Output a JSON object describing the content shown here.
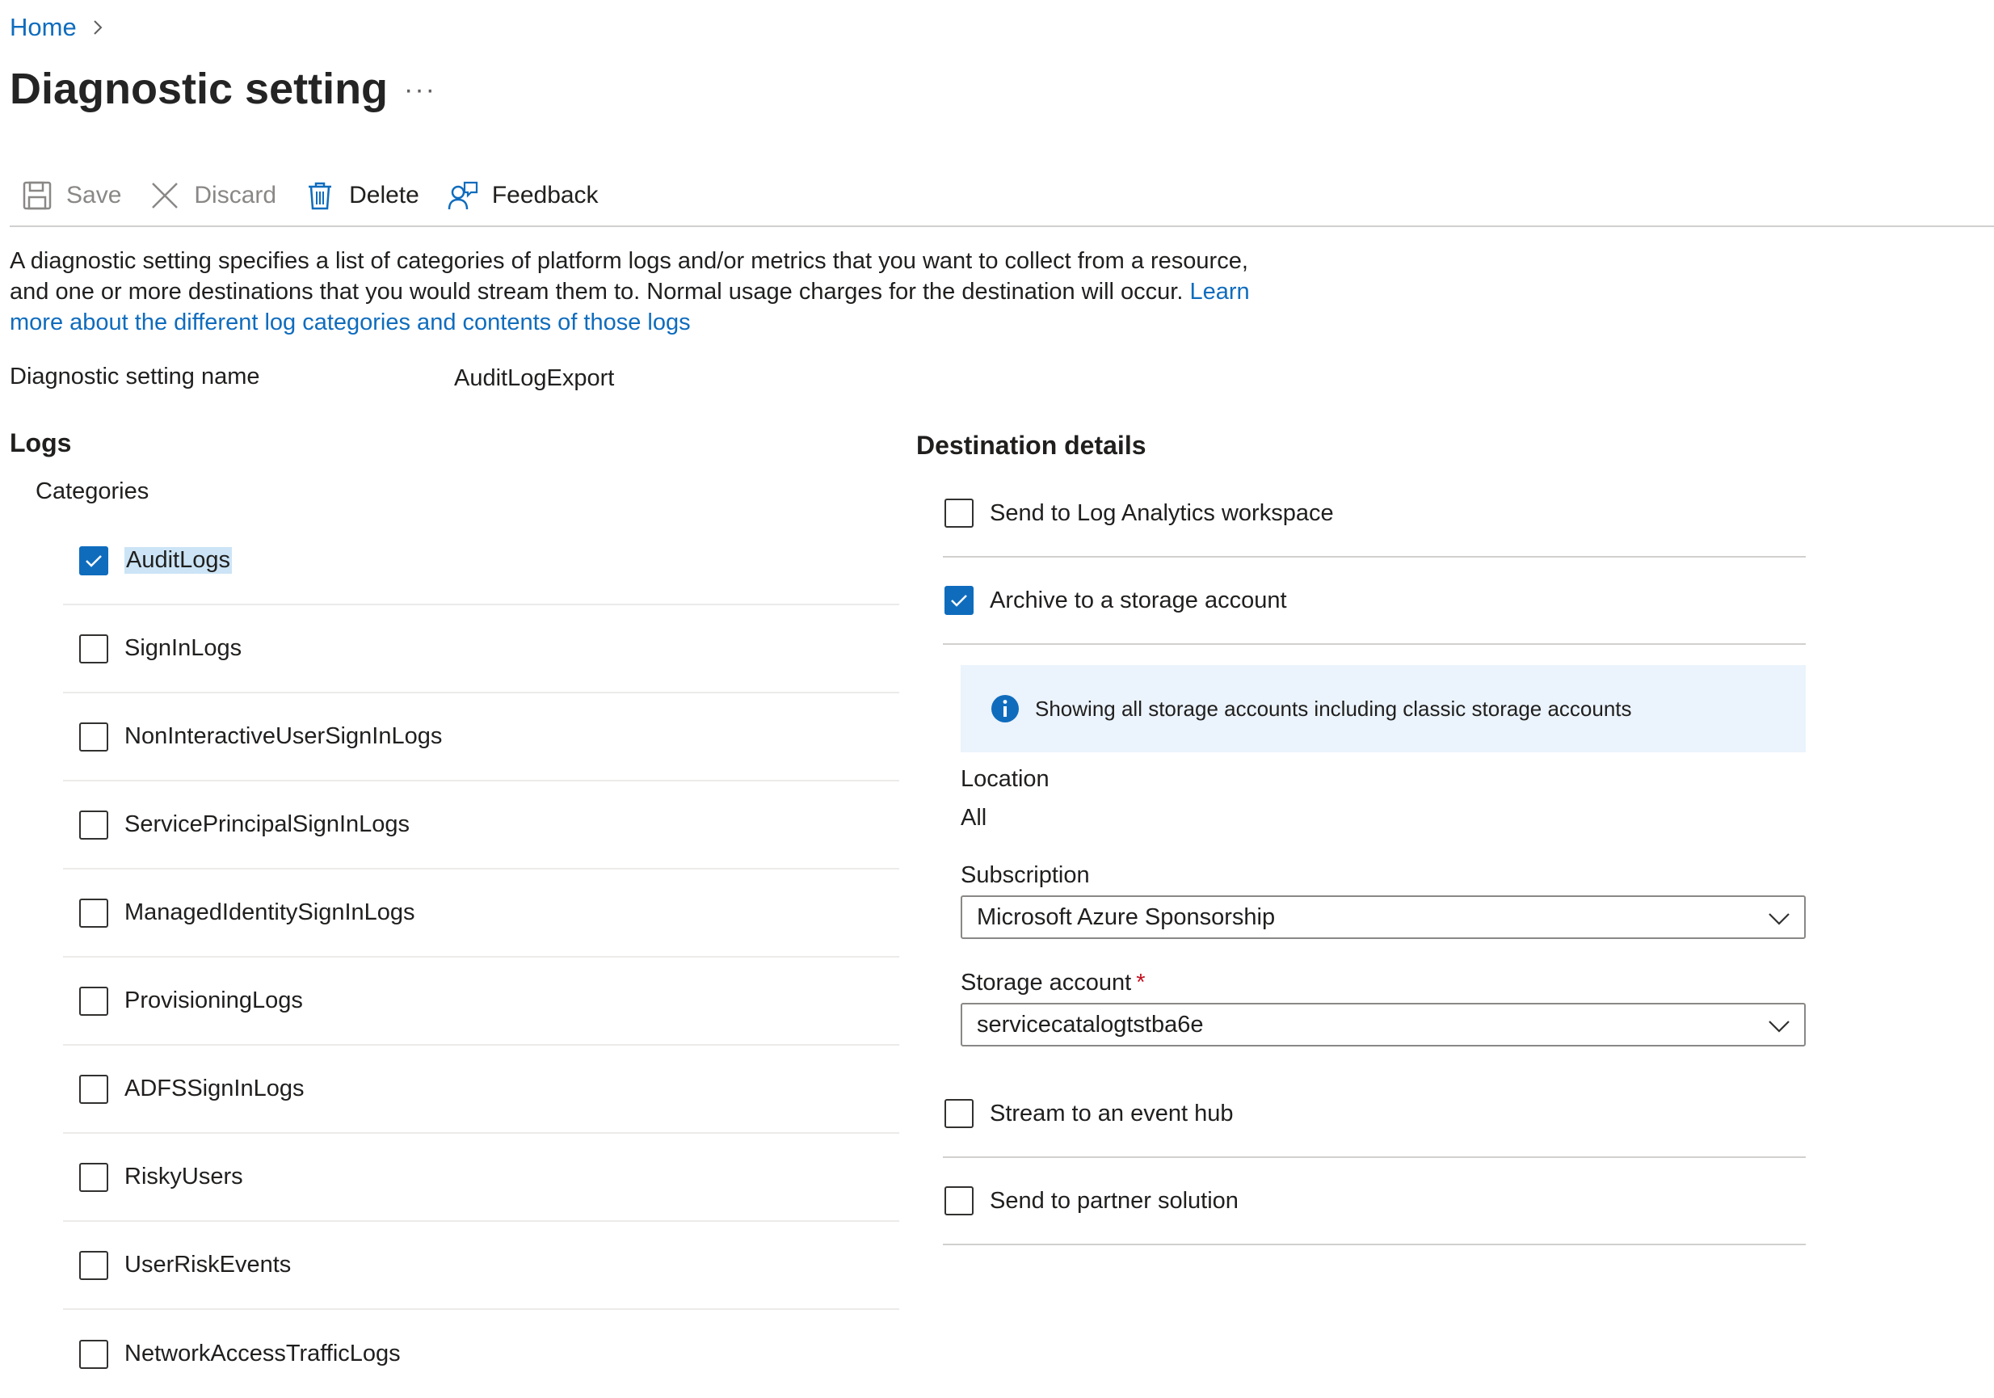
{
  "breadcrumb": {
    "home": "Home"
  },
  "page": {
    "title": "Diagnostic setting",
    "more": "···"
  },
  "toolbar": {
    "save": "Save",
    "discard": "Discard",
    "delete": "Delete",
    "feedback": "Feedback"
  },
  "description": {
    "text": "A diagnostic setting specifies a list of categories of platform logs and/or metrics that you want to collect from a resource, and one or more destinations that you would stream them to. Normal usage charges for the destination will occur. ",
    "link": "Learn more about the different log categories and contents of those logs"
  },
  "setting_name": {
    "label": "Diagnostic setting name",
    "value": "AuditLogExport"
  },
  "logs": {
    "heading": "Logs",
    "categories_label": "Categories",
    "categories": [
      {
        "label": "AuditLogs",
        "checked": true
      },
      {
        "label": "SignInLogs",
        "checked": false
      },
      {
        "label": "NonInteractiveUserSignInLogs",
        "checked": false
      },
      {
        "label": "ServicePrincipalSignInLogs",
        "checked": false
      },
      {
        "label": "ManagedIdentitySignInLogs",
        "checked": false
      },
      {
        "label": "ProvisioningLogs",
        "checked": false
      },
      {
        "label": "ADFSSignInLogs",
        "checked": false
      },
      {
        "label": "RiskyUsers",
        "checked": false
      },
      {
        "label": "UserRiskEvents",
        "checked": false
      },
      {
        "label": "NetworkAccessTrafficLogs",
        "checked": false
      }
    ]
  },
  "destination": {
    "heading": "Destination details",
    "log_analytics": {
      "label": "Send to Log Analytics workspace",
      "checked": false
    },
    "storage": {
      "label": "Archive to a storage account",
      "checked": true
    },
    "info": "Showing all storage accounts including classic storage accounts",
    "location_label": "Location",
    "location_value": "All",
    "subscription_label": "Subscription",
    "subscription_value": "Microsoft Azure Sponsorship",
    "storage_account_label": "Storage account",
    "required_mark": "*",
    "storage_account_value": "servicecatalogtstba6e",
    "event_hub": {
      "label": "Stream to an event hub",
      "checked": false
    },
    "partner": {
      "label": "Send to partner solution",
      "checked": false
    }
  },
  "colors": {
    "accent": "#0f6cbd",
    "info_bg": "#ebf3fc",
    "required": "#c50f1f"
  }
}
